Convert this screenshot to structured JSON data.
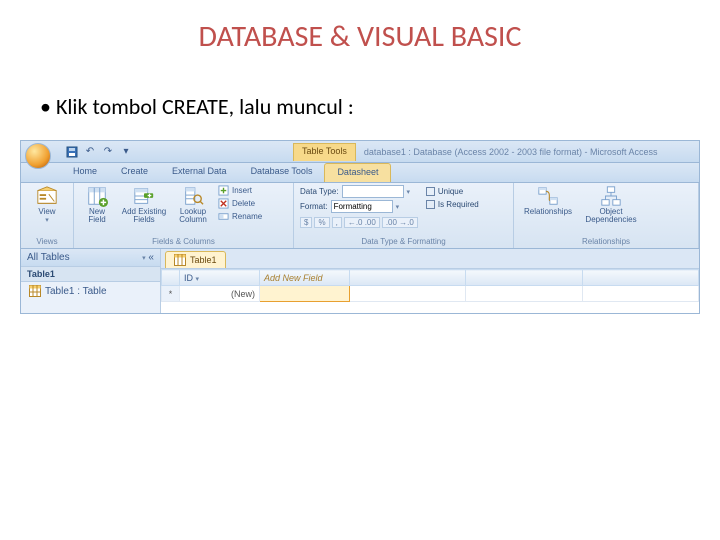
{
  "slide": {
    "title": "DATABASE & VISUAL BASIC",
    "bullet": "Klik tombol CREATE, lalu muncul :"
  },
  "titlebar": {
    "contextual_label": "Table Tools",
    "window_title": "database1 : Database (Access 2002 - 2003 file format) - Microsoft Access"
  },
  "tabs": {
    "home": "Home",
    "create": "Create",
    "external": "External Data",
    "dbtools": "Database Tools",
    "datasheet": "Datasheet"
  },
  "ribbon": {
    "views": {
      "view": "View",
      "group": "Views"
    },
    "fields": {
      "new_field": "New Field",
      "add_existing": "Add Existing Fields",
      "lookup": "Lookup Column",
      "insert": "Insert",
      "delete": "Delete",
      "rename": "Rename",
      "group": "Fields & Columns"
    },
    "datatype": {
      "data_type_label": "Data Type:",
      "data_type_value": "",
      "format_label": "Format:",
      "format_value": "Formatting",
      "unique": "Unique",
      "is_required": "Is Required",
      "currency": "$",
      "percent": "%",
      "comma": ",",
      "dec_inc": "←.0 .00",
      "dec_dec": ".00 →.0",
      "group": "Data Type & Formatting"
    },
    "rel": {
      "relationships": "Relationships",
      "object_dep": "Object Dependencies",
      "group": "Relationships"
    }
  },
  "navpane": {
    "header": "All Tables",
    "group1": "Table1",
    "item1": "Table1 : Table"
  },
  "datasheet": {
    "tab_label": "Table1",
    "col_id": "ID",
    "col_add": "Add New Field",
    "new_marker": "*",
    "new_value": "(New)"
  }
}
